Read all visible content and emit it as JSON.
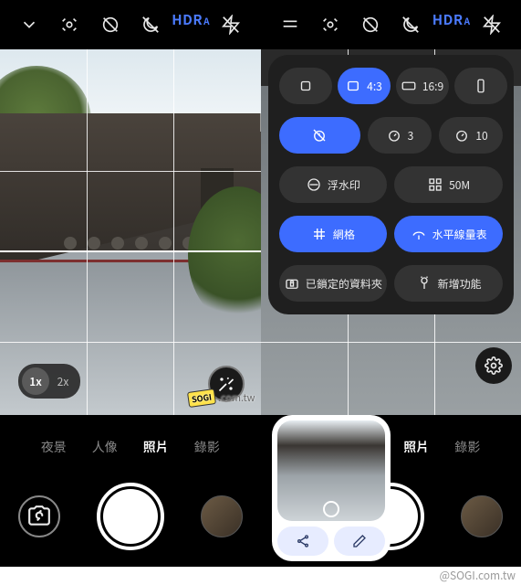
{
  "colors": {
    "accent": "#3d6cff",
    "hdr": "#4b7bff"
  },
  "topbar": {
    "hdr_label": "HDR",
    "hdr_sub": "A"
  },
  "zoom": {
    "opt1": "1x",
    "opt2": "2x"
  },
  "modes": {
    "night": "夜景",
    "portrait": "人像",
    "photo": "照片",
    "video": "錄影"
  },
  "settings": {
    "aspect": {
      "a1": "1:1",
      "a2": "4:3",
      "a3": "16:9"
    },
    "timer": {
      "t3": "3",
      "t10": "10"
    },
    "watermark": "浮水印",
    "megapixel": "50M",
    "grid": "網格",
    "level": "水平線量表",
    "locked_folder": "已鎖定的資料夾",
    "new_features": "新增功能"
  },
  "watermark": {
    "badge": "SOGI",
    "text": ".com.tw",
    "footer": "@SOGI.com.tw"
  }
}
